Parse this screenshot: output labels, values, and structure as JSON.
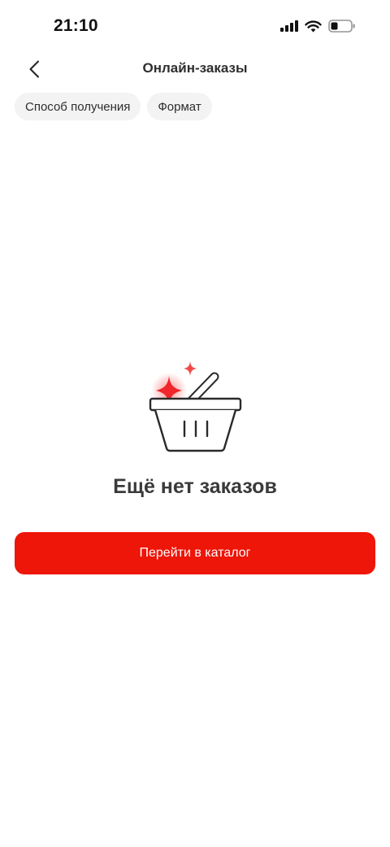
{
  "status_bar": {
    "time": "21:10"
  },
  "header": {
    "title": "Онлайн-заказы",
    "back_icon": "chevron-left-icon"
  },
  "filters": [
    {
      "label": "Способ получения"
    },
    {
      "label": "Формат"
    }
  ],
  "empty_state": {
    "title": "Ещё нет заказов",
    "illustration": "basket-icon",
    "button_label": "Перейти в каталог"
  },
  "colors": {
    "accent": "#ee1509",
    "chip_bg": "#f3f3f3",
    "text": "#2e2e2e"
  }
}
